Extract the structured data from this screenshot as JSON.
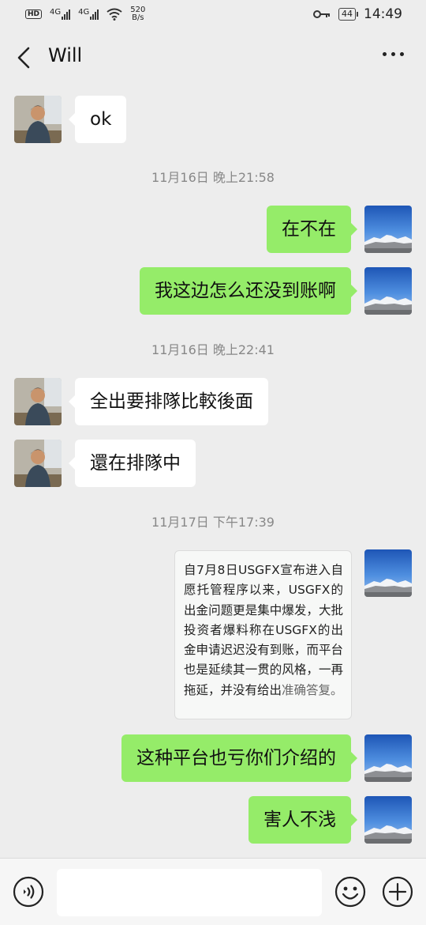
{
  "status_bar": {
    "hd": "HD",
    "net1": "4G",
    "net2": "4G",
    "speed_value": "520",
    "speed_unit": "B/s",
    "battery": "44",
    "time": "14:49"
  },
  "header": {
    "title": "Will"
  },
  "messages": [
    {
      "side": "left",
      "text": "ok"
    },
    {
      "type": "time",
      "text": "11月16日 晚上21:58"
    },
    {
      "side": "right",
      "text": "在不在"
    },
    {
      "side": "right",
      "text": "我这边怎么还没到账啊"
    },
    {
      "type": "time",
      "text": "11月16日 晚上22:41"
    },
    {
      "side": "left",
      "text": "全出要排隊比較後面"
    },
    {
      "side": "left",
      "text": "還在排隊中"
    },
    {
      "type": "time",
      "text": "11月17日 下午17:39"
    },
    {
      "side": "right",
      "type": "article",
      "text": "自7月8日USGFX宣布进入自愿托管程序以来，USGFX的出金问题更是集中爆发，大批投资者爆料称在USGFX的出金申请迟迟没有到账，而平台也是延续其一贯的风格，一再拖延，并没有给出",
      "text_faded": "准确答复。"
    },
    {
      "side": "right",
      "text": "这种平台也亏你们介绍的"
    },
    {
      "side": "right",
      "text": "害人不浅"
    }
  ],
  "input_bar": {
    "placeholder": ""
  },
  "colors": {
    "background": "#ededed",
    "sent_bubble": "#95ec69",
    "received_bubble": "#ffffff"
  },
  "icons": [
    "back-arrow-icon",
    "more-icon",
    "voice-icon",
    "emoji-icon",
    "plus-icon"
  ]
}
